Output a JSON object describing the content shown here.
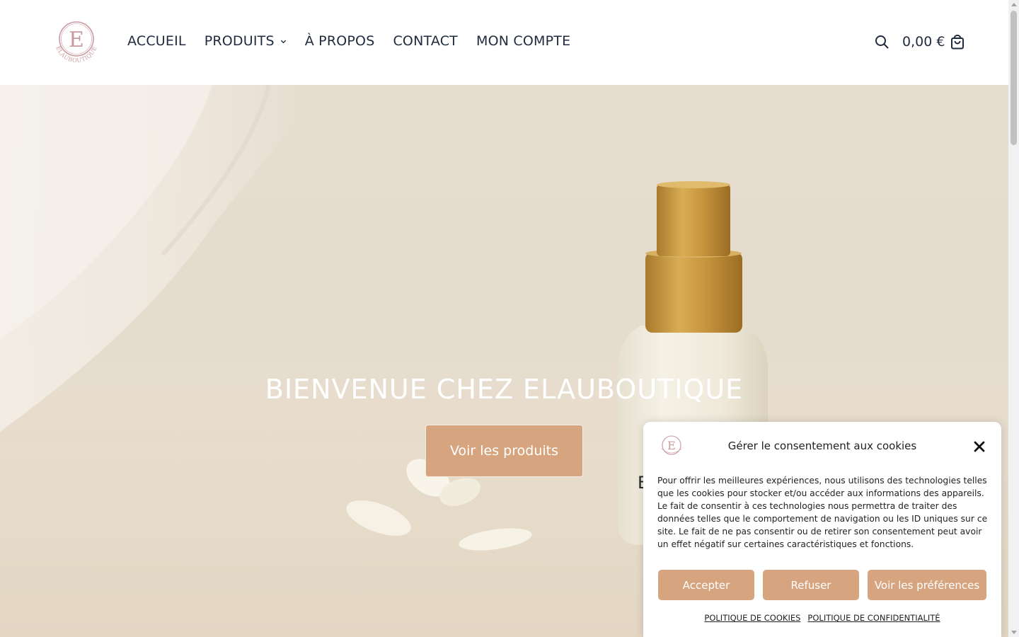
{
  "brand": {
    "logo_letter": "E",
    "logo_text": "ELAUBOUTIQUE",
    "accent_color": "#d6a47f",
    "logo_color": "#c99aa0"
  },
  "nav": {
    "items": [
      {
        "label": "ACCUEIL"
      },
      {
        "label": "PRODUITS",
        "has_dropdown": true
      },
      {
        "label": "À PROPOS"
      },
      {
        "label": "CONTACT"
      },
      {
        "label": "MON COMPTE"
      }
    ]
  },
  "header": {
    "search_icon": "search-icon",
    "cart_total": "0,00 €",
    "cart_icon": "shopping-bag-icon"
  },
  "hero": {
    "title": "BIENVENUE CHEZ ELAUBOUTIQUE",
    "button_label": "Voir les produits",
    "bottle_label_fragment": "E"
  },
  "cookie": {
    "title": "Gérer le consentement aux cookies",
    "text": "Pour offrir les meilleures expériences, nous utilisons des technologies telles que les cookies pour stocker et/ou accéder aux informations des appareils. Le fait de consentir à ces technologies nous permettra de traiter des données telles que le comportement de navigation ou les ID uniques sur ce site. Le fait de ne pas consentir ou de retirer son consentement peut avoir un effet négatif sur certaines caractéristiques et fonctions.",
    "accept_label": "Accepter",
    "refuse_label": "Refuser",
    "prefs_label": "Voir les préférences",
    "cookie_policy_link": "POLITIQUE DE COOKIES",
    "privacy_policy_link": "POLITIQUE DE CONFIDENTIALITÉ"
  }
}
